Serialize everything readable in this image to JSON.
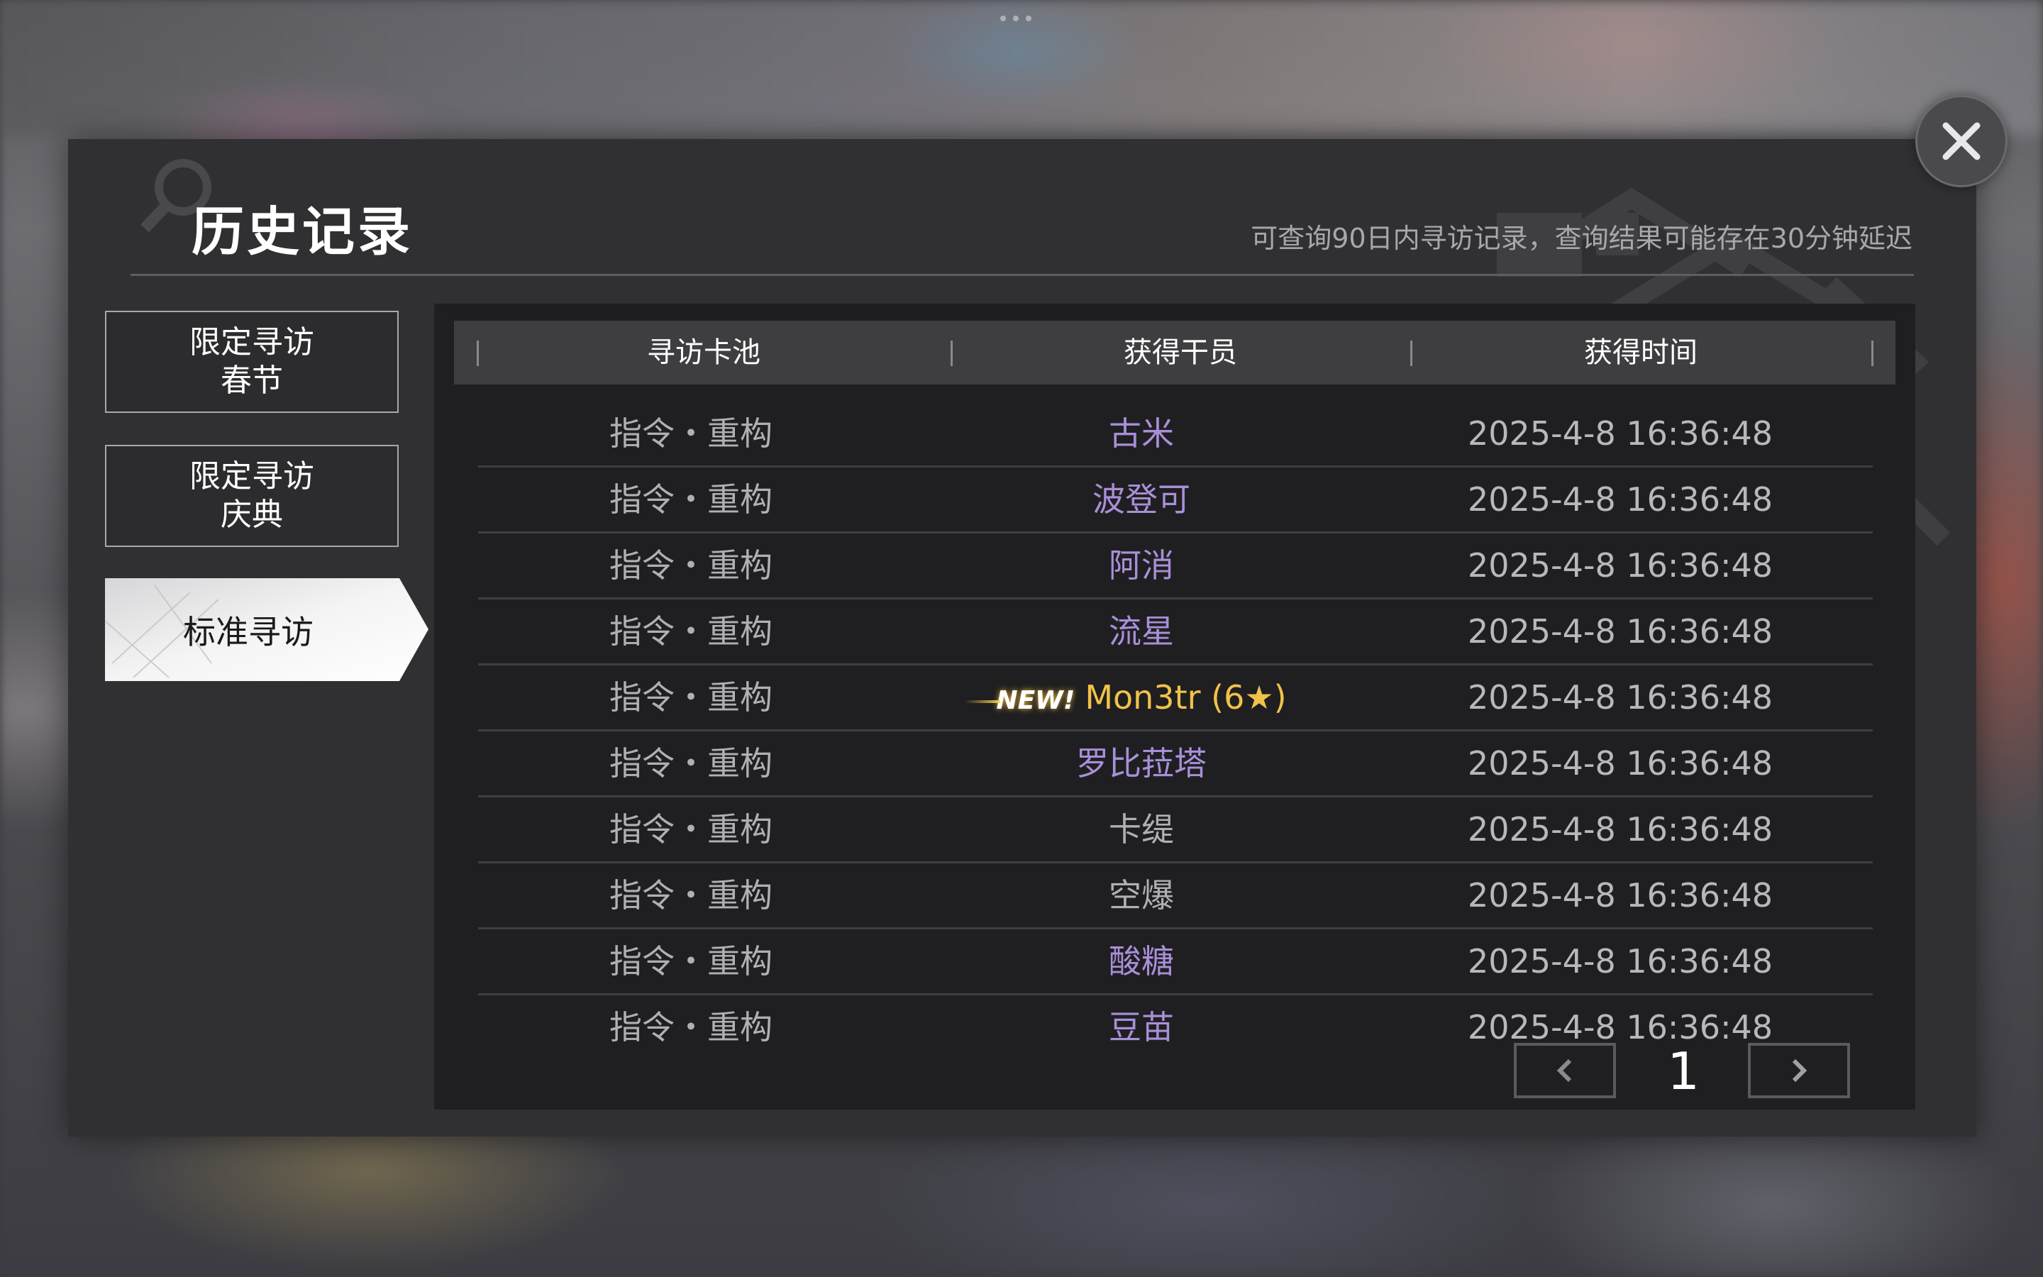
{
  "dialog": {
    "title": "历史记录",
    "note": "可查询90日内寻访记录，查询结果可能存在30分钟延迟"
  },
  "tabs": [
    {
      "line1": "限定寻访",
      "line2": "春节",
      "active": false
    },
    {
      "line1": "限定寻访",
      "line2": "庆典",
      "active": false
    },
    {
      "line1": "标准寻访",
      "line2": "",
      "active": true
    }
  ],
  "table": {
    "headers": [
      "寻访卡池",
      "获得干员",
      "获得时间"
    ],
    "rows": [
      {
        "pool": "指令・重构",
        "operator": "古米",
        "time": "2025-4-8 16:36:48",
        "color": "#a98fd8",
        "new": false
      },
      {
        "pool": "指令・重构",
        "operator": "波登可",
        "time": "2025-4-8 16:36:48",
        "color": "#a98fd8",
        "new": false
      },
      {
        "pool": "指令・重构",
        "operator": "阿消",
        "time": "2025-4-8 16:36:48",
        "color": "#a98fd8",
        "new": false
      },
      {
        "pool": "指令・重构",
        "operator": "流星",
        "time": "2025-4-8 16:36:48",
        "color": "#a98fd8",
        "new": false
      },
      {
        "pool": "指令・重构",
        "operator": "Mon3tr (6★)",
        "time": "2025-4-8 16:36:48",
        "color": "#f0c24a",
        "new": true,
        "new_label": "NEW!"
      },
      {
        "pool": "指令・重构",
        "operator": "罗比菈塔",
        "time": "2025-4-8 16:36:48",
        "color": "#a98fd8",
        "new": false
      },
      {
        "pool": "指令・重构",
        "operator": "卡缇",
        "time": "2025-4-8 16:36:48",
        "color": "#b0b0b4",
        "new": false
      },
      {
        "pool": "指令・重构",
        "operator": "空爆",
        "time": "2025-4-8 16:36:48",
        "color": "#b0b0b4",
        "new": false
      },
      {
        "pool": "指令・重构",
        "operator": "酸糖",
        "time": "2025-4-8 16:36:48",
        "color": "#a98fd8",
        "new": false
      },
      {
        "pool": "指令・重构",
        "operator": "豆苗",
        "time": "2025-4-8 16:36:48",
        "color": "#a98fd8",
        "new": false
      }
    ]
  },
  "pagination": {
    "page": "1"
  },
  "icons": {
    "close": "close-icon",
    "prev": "chevron-left-icon",
    "next": "chevron-right-icon",
    "search_deco": "search-icon"
  }
}
